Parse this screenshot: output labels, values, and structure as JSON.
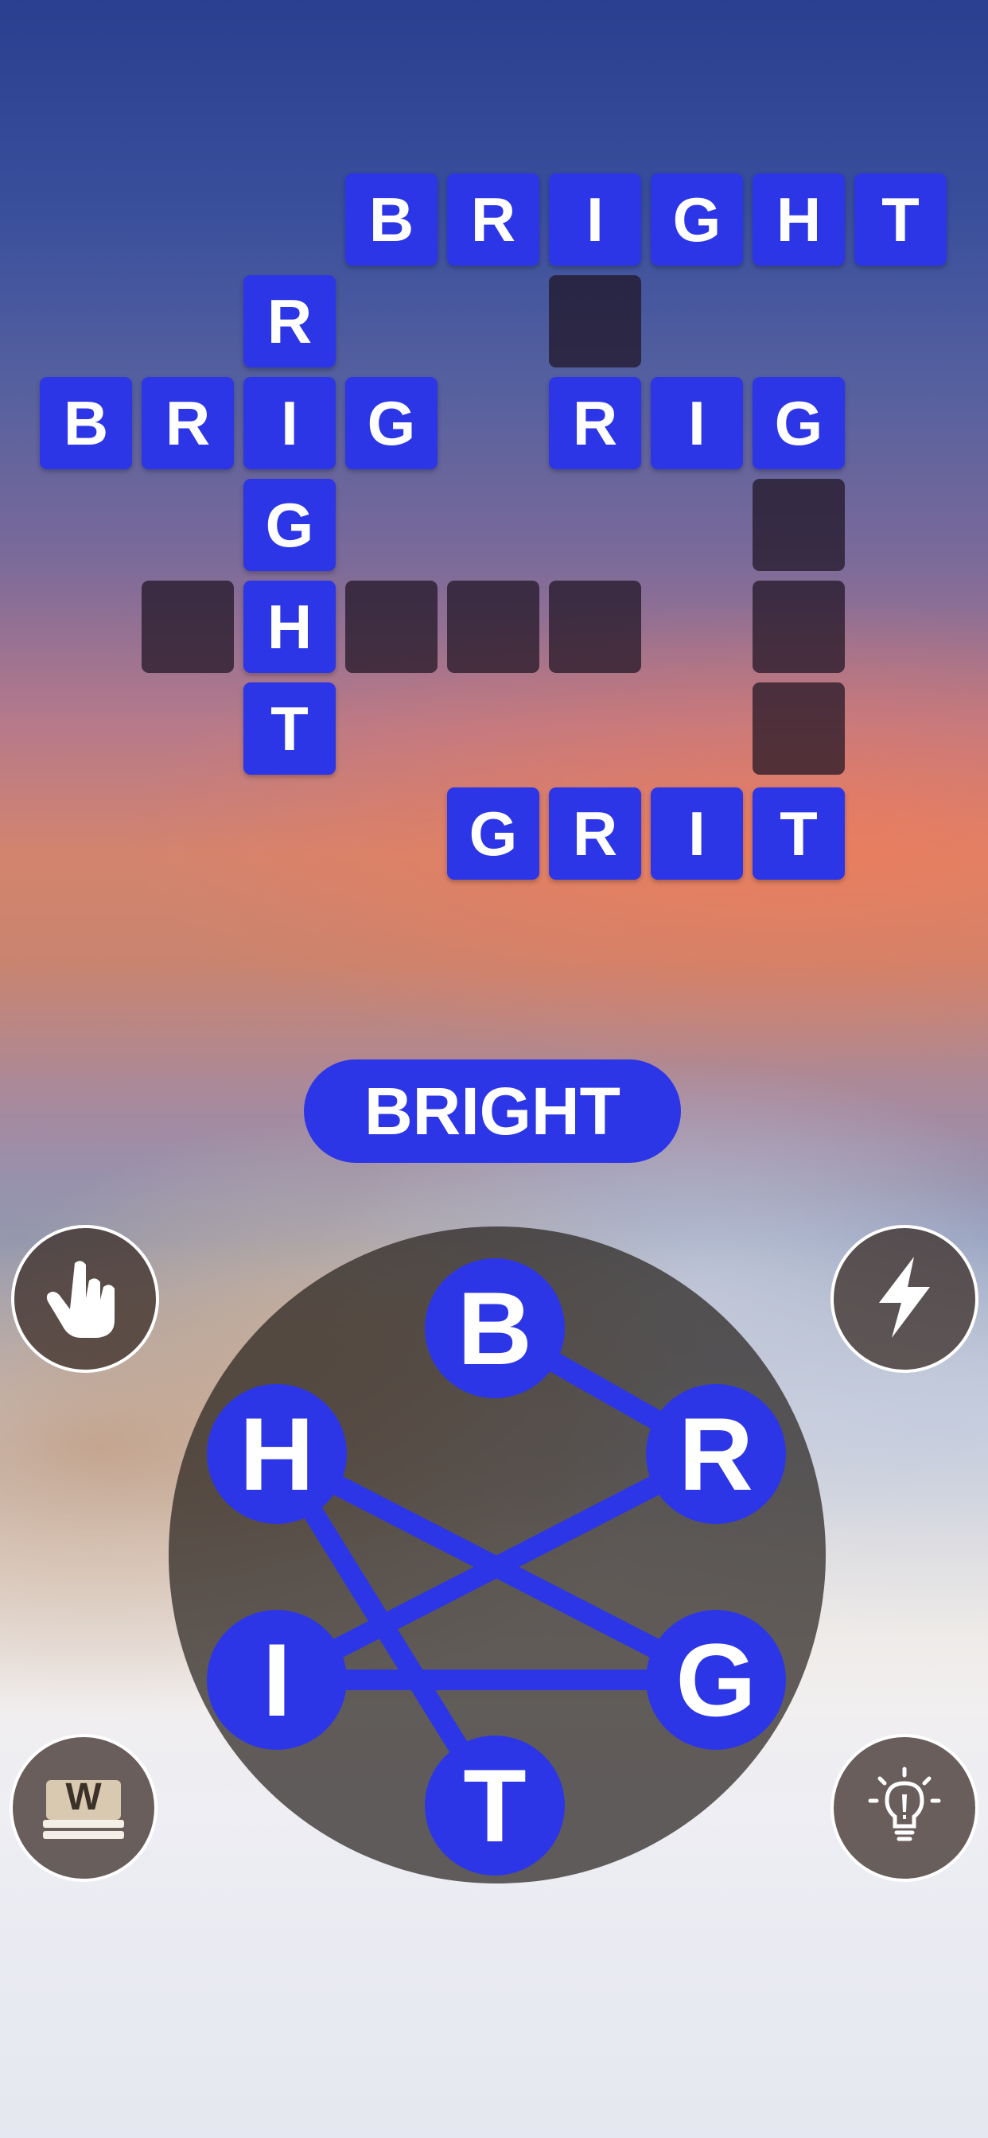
{
  "puzzle": {
    "tiles": [
      {
        "r": 0,
        "c": 3,
        "letter": "B"
      },
      {
        "r": 0,
        "c": 4,
        "letter": "R"
      },
      {
        "r": 0,
        "c": 5,
        "letter": "I"
      },
      {
        "r": 0,
        "c": 6,
        "letter": "G"
      },
      {
        "r": 0,
        "c": 7,
        "letter": "H"
      },
      {
        "r": 0,
        "c": 8,
        "letter": "T"
      },
      {
        "r": 1,
        "c": 2,
        "letter": "R"
      },
      {
        "r": 1,
        "c": 5,
        "letter": ""
      },
      {
        "r": 2,
        "c": 0,
        "letter": "B"
      },
      {
        "r": 2,
        "c": 1,
        "letter": "R"
      },
      {
        "r": 2,
        "c": 2,
        "letter": "I"
      },
      {
        "r": 2,
        "c": 3,
        "letter": "G"
      },
      {
        "r": 2,
        "c": 5,
        "letter": "R"
      },
      {
        "r": 2,
        "c": 6,
        "letter": "I"
      },
      {
        "r": 2,
        "c": 7,
        "letter": "G"
      },
      {
        "r": 3,
        "c": 2,
        "letter": "G"
      },
      {
        "r": 3,
        "c": 7,
        "letter": ""
      },
      {
        "r": 4,
        "c": 1,
        "letter": ""
      },
      {
        "r": 4,
        "c": 2,
        "letter": "H"
      },
      {
        "r": 4,
        "c": 3,
        "letter": ""
      },
      {
        "r": 4,
        "c": 4,
        "letter": ""
      },
      {
        "r": 4,
        "c": 5,
        "letter": ""
      },
      {
        "r": 4,
        "c": 7,
        "letter": ""
      },
      {
        "r": 5,
        "c": 2,
        "letter": "T"
      },
      {
        "r": 5,
        "c": 7,
        "letter": ""
      },
      {
        "r": 6,
        "c": 4,
        "letter": "G"
      },
      {
        "r": 6,
        "c": 5,
        "letter": "R"
      },
      {
        "r": 6,
        "c": 6,
        "letter": "I"
      },
      {
        "r": 6,
        "c": 7,
        "letter": "T"
      }
    ]
  },
  "current_word": "BRIGHT",
  "wheel": {
    "letters": [
      "B",
      "R",
      "G",
      "T",
      "I",
      "H"
    ],
    "path": [
      "B",
      "R",
      "I",
      "G",
      "H",
      "T"
    ]
  },
  "buttons": {
    "left_top_icon": "pointing-hand-icon",
    "left_bottom_icon": "word-book-icon",
    "left_bottom_glyph": "W",
    "right_top_icon": "lightning-icon",
    "right_bottom_icon": "lightbulb-icon"
  },
  "colors": {
    "tile": "#2d36e6",
    "empty_tile": "#1e1423",
    "wheel_line": "#2d36e6"
  }
}
